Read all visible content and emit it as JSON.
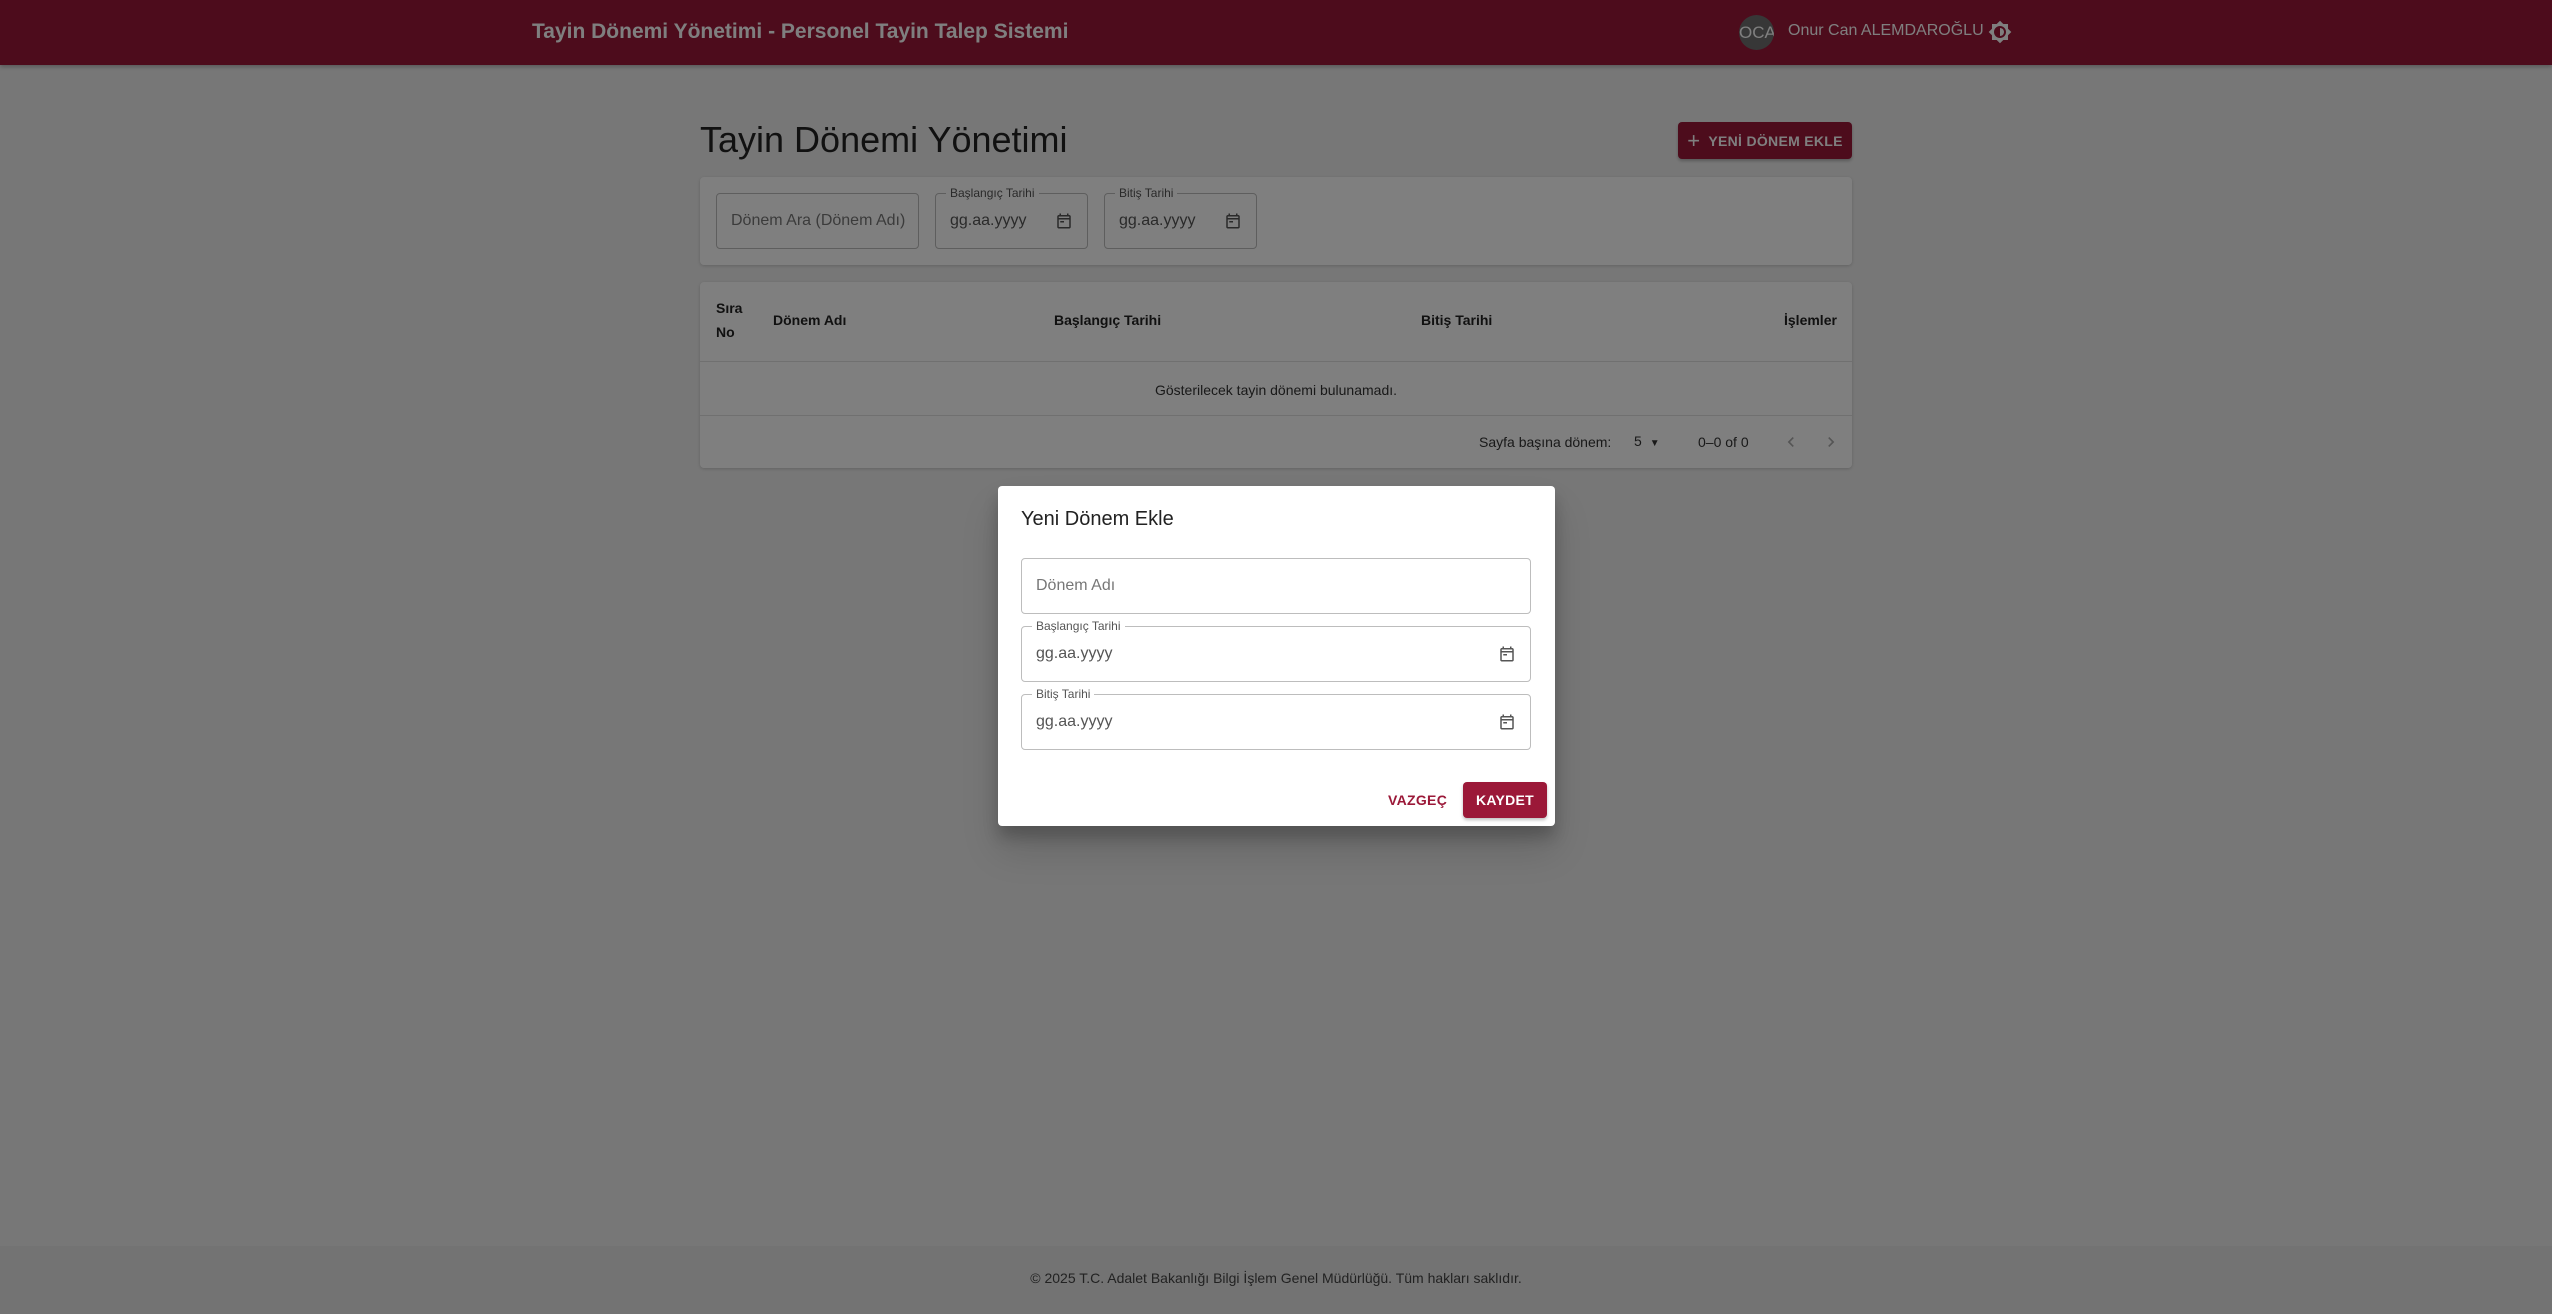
{
  "header": {
    "title": "Tayin Dönemi Yönetimi - Personel Tayin Talep Sistemi",
    "user_initials": "OCA",
    "user_name": "Onur Can ALEMDAROĞLU",
    "theme_icon": "brightness-icon"
  },
  "page": {
    "title": "Tayin Dönemi Yönetimi",
    "add_button_label": "YENİ DÖNEM EKLE"
  },
  "filters": {
    "search_placeholder": "Dönem Ara (Dönem Adı)",
    "start_date_label": "Başlangıç Tarihi",
    "start_date_value": "gg.aa.yyyy",
    "end_date_label": "Bitiş Tarihi",
    "end_date_value": "gg.aa.yyyy"
  },
  "table": {
    "columns": [
      "Sıra No",
      "Dönem Adı",
      "Başlangıç Tarihi",
      "Bitiş Tarihi",
      "İşlemler"
    ],
    "empty_message": "Gösterilecek tayin dönemi bulunamadı.",
    "rows_per_page_label": "Sayfa başına dönem:",
    "rows_per_page_value": "5",
    "range_text": "0–0 of 0"
  },
  "dialog": {
    "title": "Yeni Dönem Ekle",
    "name_placeholder": "Dönem Adı",
    "start_date_label": "Başlangıç Tarihi",
    "start_date_value": "gg.aa.yyyy",
    "end_date_label": "Bitiş Tarihi",
    "end_date_value": "gg.aa.yyyy",
    "cancel_label": "VAZGEÇ",
    "save_label": "KAYDET"
  },
  "footer": {
    "text": "© 2025 T.C. Adalet Bakanlığı Bilgi İşlem Genel Müdürlüğü. Tüm hakları saklıdır."
  },
  "colors": {
    "primary": "#9b1838",
    "background": "#efefef"
  }
}
